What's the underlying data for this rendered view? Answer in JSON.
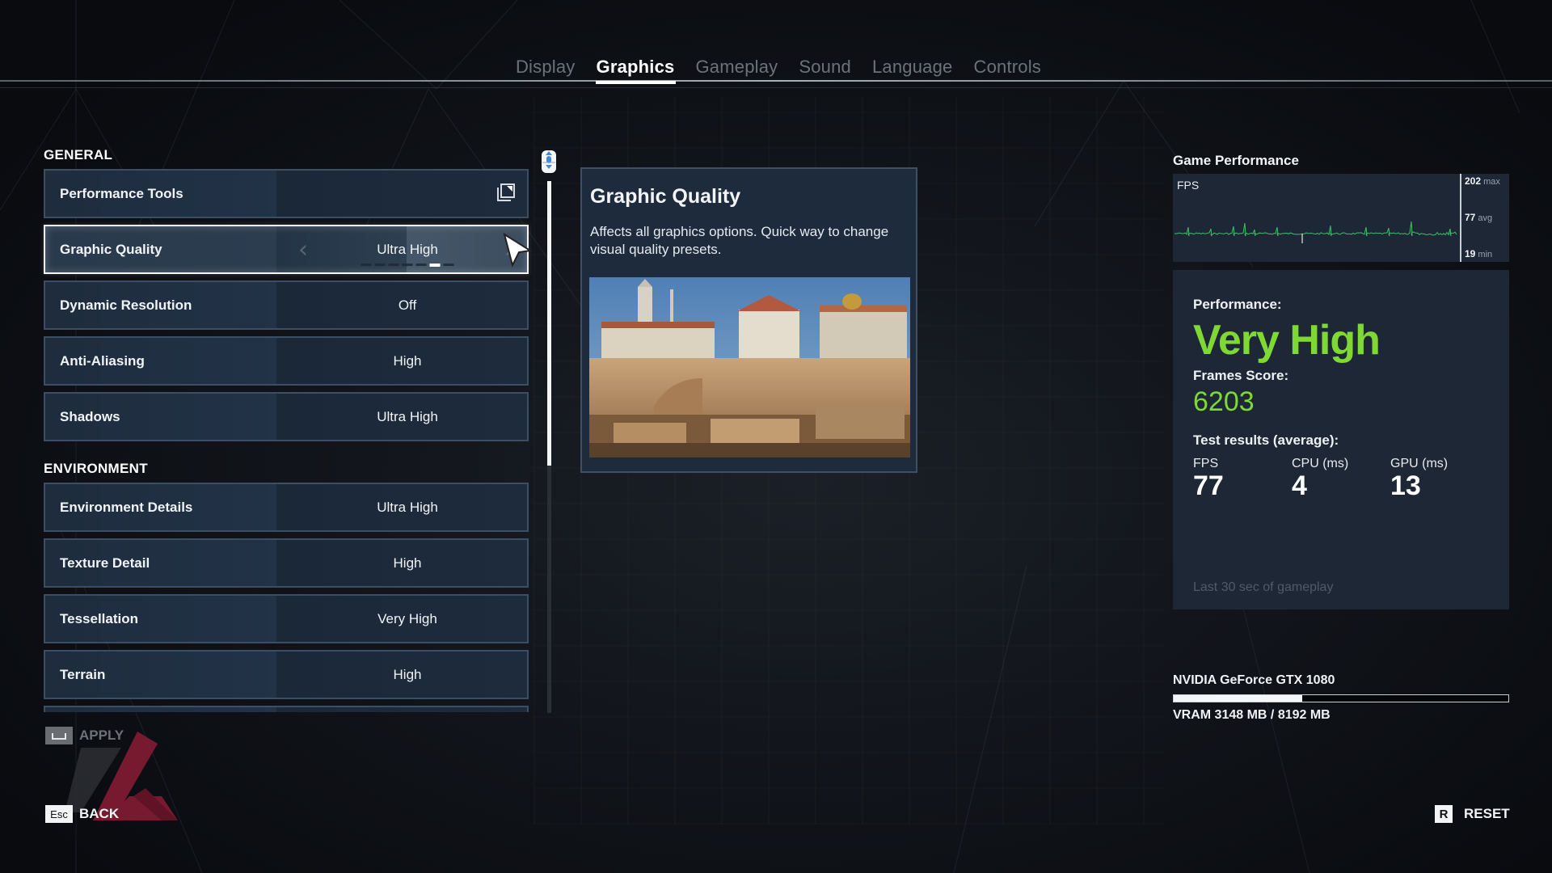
{
  "tabs": [
    {
      "label": "Display",
      "active": false
    },
    {
      "label": "Graphics",
      "active": true
    },
    {
      "label": "Gameplay",
      "active": false
    },
    {
      "label": "Sound",
      "active": false
    },
    {
      "label": "Language",
      "active": false
    },
    {
      "label": "Controls",
      "active": false
    }
  ],
  "sections": {
    "general": {
      "title": "GENERAL",
      "rows": [
        {
          "label": "Performance Tools",
          "value": "",
          "icon": "external-window-icon"
        },
        {
          "label": "Graphic Quality",
          "value": "Ultra High",
          "selected": true,
          "preset_count": 7,
          "preset_index": 6
        },
        {
          "label": "Dynamic Resolution",
          "value": "Off"
        },
        {
          "label": "Anti-Aliasing",
          "value": "High"
        },
        {
          "label": "Shadows",
          "value": "Ultra High"
        }
      ]
    },
    "environment": {
      "title": "ENVIRONMENT",
      "rows": [
        {
          "label": "Environment Details",
          "value": "Ultra High"
        },
        {
          "label": "Texture Detail",
          "value": "High"
        },
        {
          "label": "Tessellation",
          "value": "Very High"
        },
        {
          "label": "Terrain",
          "value": "High"
        }
      ]
    }
  },
  "description": {
    "title": "Graphic Quality",
    "text": "Affects all graphics options. Quick way to change visual quality presets.",
    "image": "city-preview-image"
  },
  "performance": {
    "title": "Game Performance",
    "fps_chart": {
      "label": "FPS",
      "max_value": "202",
      "max_label": "max",
      "avg_value": "77",
      "avg_label": "avg",
      "min_value": "19",
      "min_label": "min",
      "line_color": "#3fbf6a"
    },
    "rating_label": "Performance:",
    "rating_value": "Very High",
    "score_label": "Frames Score:",
    "score_value": "6203",
    "results_label": "Test results (average):",
    "stats": [
      {
        "label": "FPS",
        "value": "77"
      },
      {
        "label": "CPU (ms)",
        "value": "4"
      },
      {
        "label": "GPU (ms)",
        "value": "13"
      }
    ],
    "footnote": "Last 30 sec of gameplay",
    "accent_color": "#7fd934"
  },
  "gpu": {
    "name": "NVIDIA GeForce GTX 1080",
    "vram_used_mb": 3148,
    "vram_total_mb": 8192,
    "vram_text": "VRAM 3148 MB / 8192 MB"
  },
  "actions": {
    "apply": {
      "key": "␣",
      "label": "APPLY",
      "enabled": false
    },
    "back": {
      "key": "Esc",
      "label": "BACK"
    },
    "reset": {
      "key": "R",
      "label": "RESET"
    }
  }
}
